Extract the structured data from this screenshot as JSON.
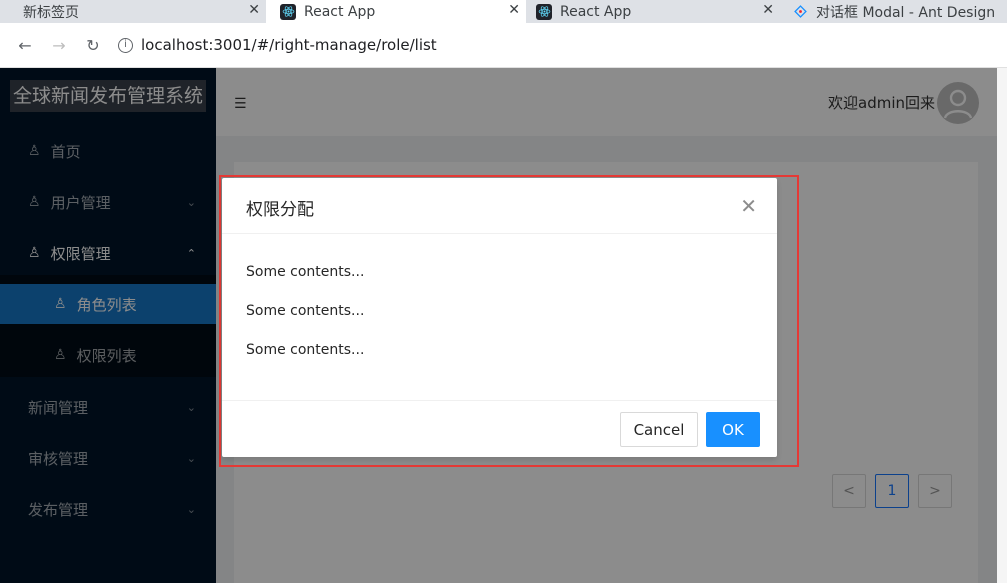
{
  "browser": {
    "tabs": [
      {
        "title": "新标签页"
      },
      {
        "title": "React App"
      },
      {
        "title": "React App"
      },
      {
        "title": "对话框 Modal - Ant Design"
      }
    ],
    "tab_close_glyph": "✕",
    "url": "localhost:3001/#/right-manage/role/list"
  },
  "sider": {
    "logo": "全球新闻发布管理系统",
    "items": [
      {
        "label": "首页"
      },
      {
        "label": "用户管理"
      },
      {
        "label": "权限管理"
      },
      {
        "label": "角色列表"
      },
      {
        "label": "权限列表"
      },
      {
        "label": "新闻管理"
      },
      {
        "label": "审核管理"
      },
      {
        "label": "发布管理"
      }
    ]
  },
  "header": {
    "welcome": "欢迎admin回来"
  },
  "pagination": {
    "current": "1",
    "prev": "<",
    "next": ">"
  },
  "modal": {
    "title": "权限分配",
    "contents": [
      "Some contents...",
      "Some contents...",
      "Some contents..."
    ],
    "cancel_label": "Cancel",
    "ok_label": "OK"
  },
  "colors": {
    "sider_bg": "#001529",
    "menu_selected": "#1677c7",
    "primary": "#1890ff",
    "highlight_outline": "#e53935"
  },
  "icons": {
    "back": "back-arrow-icon",
    "forward": "forward-arrow-icon",
    "reload": "reload-icon",
    "info": "info-icon",
    "menu_item": "user-icon",
    "menu_fold": "menu-fold-icon",
    "close": "close-icon",
    "avatar": "user-avatar-icon"
  }
}
